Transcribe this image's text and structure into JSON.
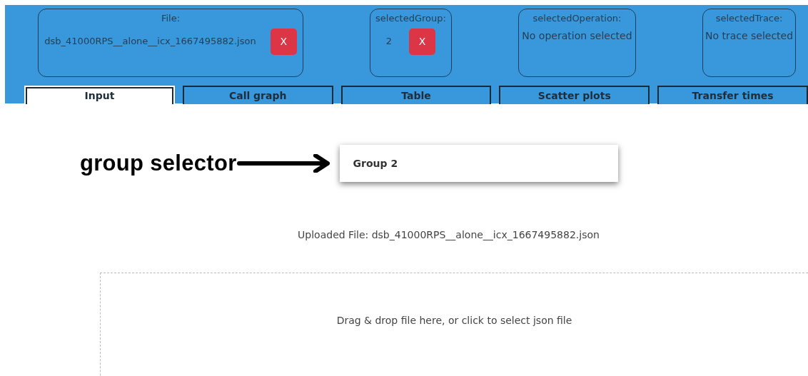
{
  "info_boxes": [
    {
      "label": "File:",
      "value": "dsb_41000RPS__alone__icx_1667495882.json",
      "clear_button": "X",
      "kind": "clearable"
    },
    {
      "label": "selectedGroup:",
      "value": "2",
      "clear_button": "X",
      "kind": "clearable"
    },
    {
      "label": "selectedOperation:",
      "value": "No operation selected",
      "kind": "plain"
    },
    {
      "label": "selectedTrace:",
      "value": "No trace selected",
      "kind": "plain"
    }
  ],
  "tabs": [
    {
      "label": "Input",
      "selected": true
    },
    {
      "label": "Call graph",
      "selected": false
    },
    {
      "label": "Table",
      "selected": false
    },
    {
      "label": "Scatter plots",
      "selected": false
    },
    {
      "label": "Transfer times",
      "selected": false
    }
  ],
  "annotation": {
    "label": "group selector"
  },
  "group_selector": {
    "value": "Group 2"
  },
  "uploaded_file": "Uploaded File: dsb_41000RPS__alone__icx_1667495882.json",
  "dropzone": {
    "text": "Drag & drop file here, or click to select json file"
  }
}
